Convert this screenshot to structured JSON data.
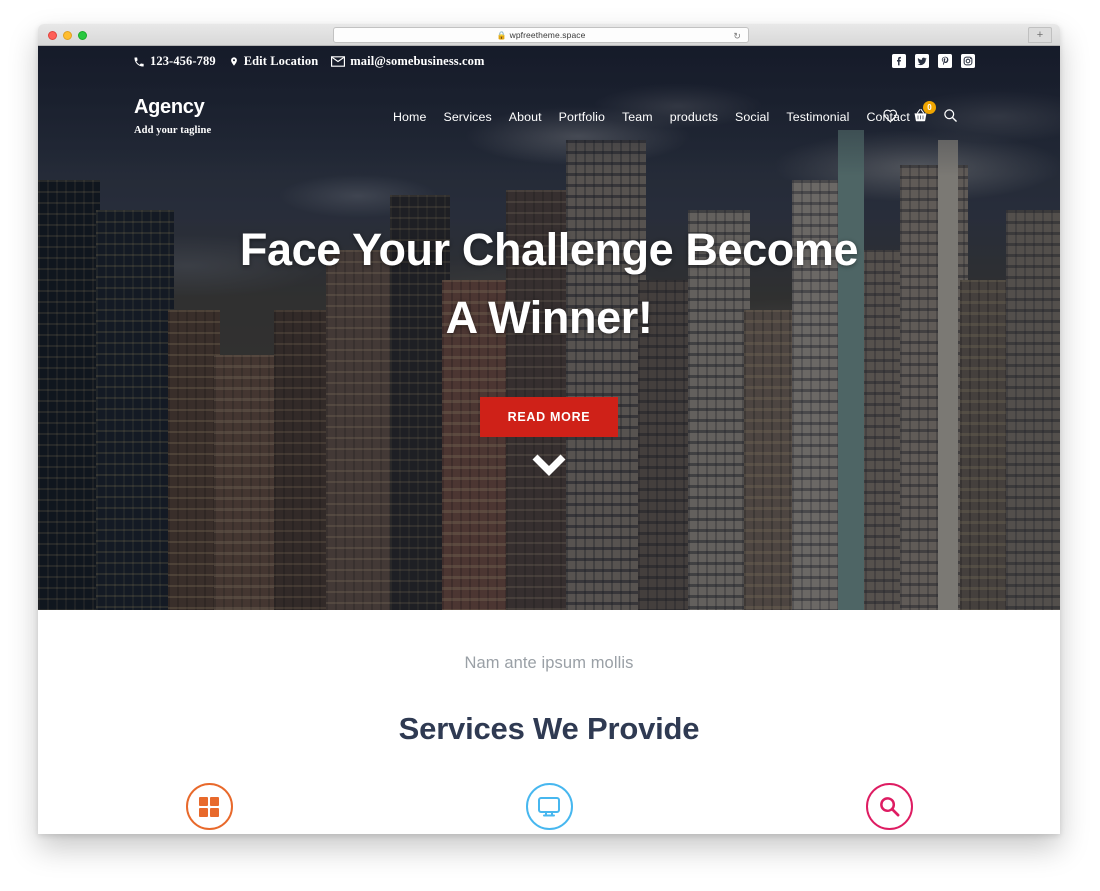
{
  "browser": {
    "url": "wpfreetheme.space",
    "lock_icon": "lock-icon",
    "reload_icon": "reload-icon",
    "new_tab_label": "+",
    "traffic_lights": [
      "close-red",
      "minimize-yellow",
      "maximize-green"
    ]
  },
  "topbar": {
    "phone": "123-456-789",
    "phone_icon": "phone-icon",
    "location": "Edit Location",
    "location_icon": "map-pin-icon",
    "email": "mail@somebusiness.com",
    "email_icon": "envelope-icon",
    "social": [
      {
        "name": "facebook-icon",
        "label": "f"
      },
      {
        "name": "twitter-icon",
        "label": "t"
      },
      {
        "name": "pinterest-icon",
        "label": "p"
      },
      {
        "name": "instagram-icon",
        "label": "i"
      }
    ]
  },
  "header": {
    "brand": "Agency",
    "tagline": "Add your tagline",
    "menu": [
      {
        "label": "Home"
      },
      {
        "label": "Services"
      },
      {
        "label": "About"
      },
      {
        "label": "Portfolio"
      },
      {
        "label": "Team"
      },
      {
        "label": "products"
      },
      {
        "label": "Social"
      },
      {
        "label": "Testimonial"
      },
      {
        "label": "Contact"
      }
    ],
    "icons": {
      "wishlist": "heart-icon",
      "cart": "shopping-basket-icon",
      "cart_count": "0",
      "cart_badge_color": "#f0a500",
      "search": "search-icon"
    }
  },
  "hero": {
    "title": "Face Your Challenge Become A Winner!",
    "cta_label": "READ MORE",
    "cta_color": "#cf2118",
    "scroll_icon": "chevron-down-icon"
  },
  "services": {
    "subtitle": "Nam ante ipsum mollis",
    "title": "Services We Provide",
    "title_color": "#2f3a52",
    "items": [
      {
        "icon": "grid-squares-icon",
        "color": "#e8692b"
      },
      {
        "icon": "desktop-monitor-icon",
        "color": "#47b7ef"
      },
      {
        "icon": "magnifier-search-icon",
        "color": "#de1c62"
      }
    ]
  }
}
